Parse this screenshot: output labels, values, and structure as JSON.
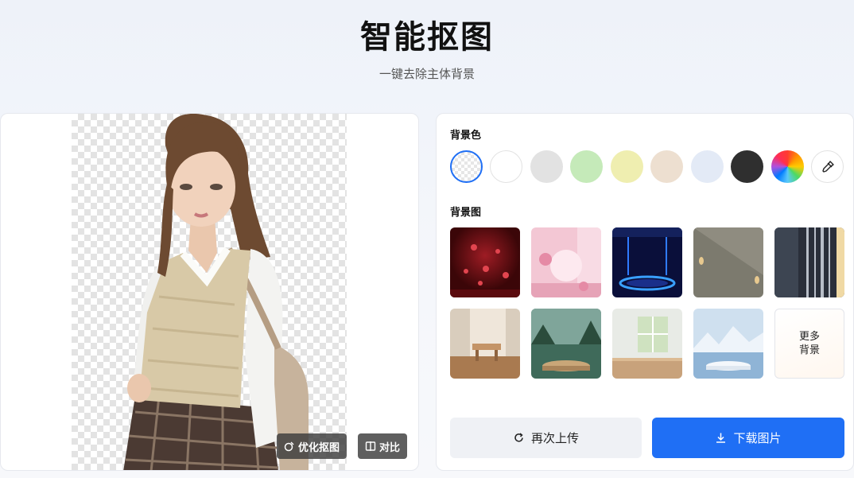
{
  "header": {
    "title": "智能抠图",
    "subtitle": "一键去除主体背景"
  },
  "preview": {
    "refine_label": "优化抠图",
    "compare_label": "对比",
    "icons": {
      "refine": "refine-icon",
      "compare": "compare-icon"
    }
  },
  "options": {
    "bg_color_label": "背景色",
    "bg_colors": [
      "transparent",
      "#ffffff",
      "#e2e2e2",
      "#c5eab9",
      "#efeeb0",
      "#eddfd0",
      "#e3eaf6",
      "#2f2f2f",
      "rainbow",
      "eyedropper"
    ],
    "bg_image_label": "背景图",
    "bg_images": [
      "red-hearts",
      "pink-room",
      "neon-stage",
      "beige-wall",
      "dark-stripes",
      "white-curtain",
      "forest-podium",
      "window-table",
      "snow-lake"
    ],
    "more_bg_label": "更多\n背景"
  },
  "actions": {
    "reupload_label": "再次上传",
    "download_label": "下载图片",
    "icons": {
      "reupload": "refresh-icon",
      "download": "download-icon"
    }
  },
  "colors": {
    "accent": "#1f6ff5"
  }
}
